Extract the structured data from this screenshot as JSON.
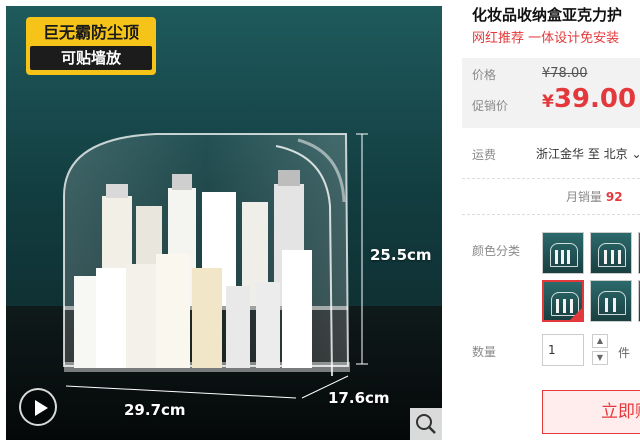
{
  "gallery": {
    "badge_line1": "巨无霸防尘顶",
    "badge_line2": "可贴墙放",
    "dim_height": "25.5cm",
    "dim_width": "29.7cm",
    "dim_depth": "17.6cm",
    "play_icon": "play-icon",
    "zoom_icon": "search-icon"
  },
  "product": {
    "title": "化妆品收纳盒亚克力护",
    "subtitle": "网红推荐 一体设计免安装"
  },
  "price": {
    "orig_label": "价格",
    "orig_value": "¥78.00",
    "promo_label": "促销价",
    "currency": "¥",
    "promo_value": "39.00"
  },
  "shipping": {
    "label": "运费",
    "route": "浙江金华 至 北京"
  },
  "sales": {
    "label": "月销量",
    "value": "92"
  },
  "variants": {
    "label": "颜色分类"
  },
  "quantity": {
    "label": "数量",
    "value": "1",
    "unit": "件"
  },
  "actions": {
    "buy_now": "立即购买"
  },
  "colors": {
    "accent": "#e4393c",
    "badge": "#f6c419",
    "background": "#1f5a5c"
  }
}
